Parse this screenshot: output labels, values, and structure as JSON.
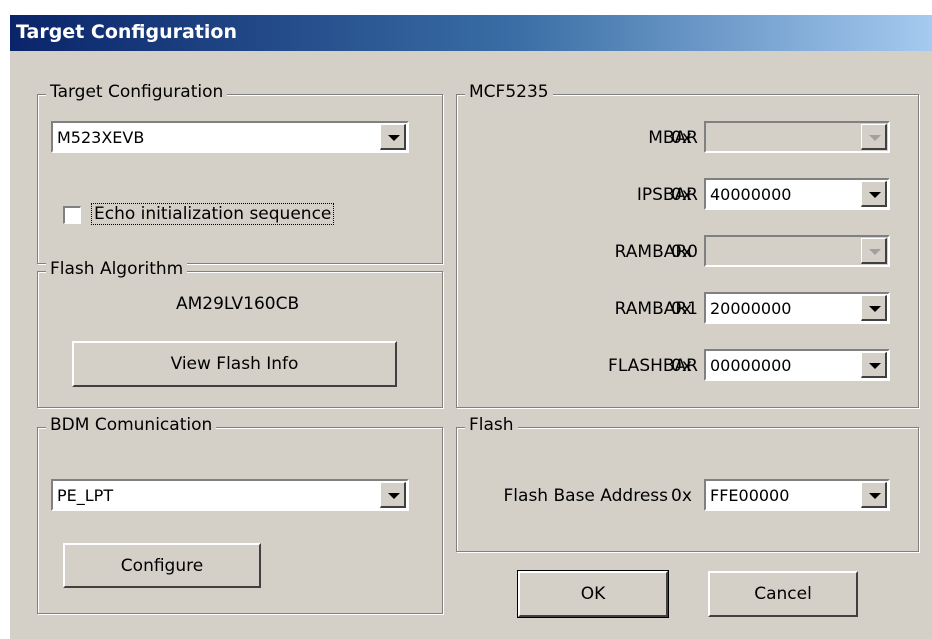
{
  "window": {
    "title": "Target Configuration"
  },
  "target_group": {
    "legend": "Target Configuration",
    "combo_value": "M523XEVB",
    "echo_checkbox_label": "Echo initialization sequence",
    "echo_checked": false
  },
  "flash_algorithm": {
    "legend": "Flash Algorithm",
    "algorithm": "AM29LV160CB",
    "view_button": "View Flash Info"
  },
  "bdm": {
    "legend": "BDM Comunication",
    "combo_value": "PE_LPT",
    "configure_button": "Configure"
  },
  "mcf": {
    "legend": "MCF5235",
    "rows": [
      {
        "label": "MBAR",
        "prefix": "0x",
        "value": "",
        "enabled": false
      },
      {
        "label": "IPSBAR",
        "prefix": "0x",
        "value": "40000000",
        "enabled": true
      },
      {
        "label": "RAMBAR0",
        "prefix": "0x",
        "value": "",
        "enabled": false
      },
      {
        "label": "RAMBAR1",
        "prefix": "0x",
        "value": "20000000",
        "enabled": true
      },
      {
        "label": "FLASHBAR",
        "prefix": "0x",
        "value": "00000000",
        "enabled": true
      }
    ]
  },
  "flash": {
    "legend": "Flash",
    "base_label": "Flash Base Address",
    "prefix": "0x",
    "base_value": "FFE00000"
  },
  "buttons": {
    "ok": "OK",
    "cancel": "Cancel"
  }
}
